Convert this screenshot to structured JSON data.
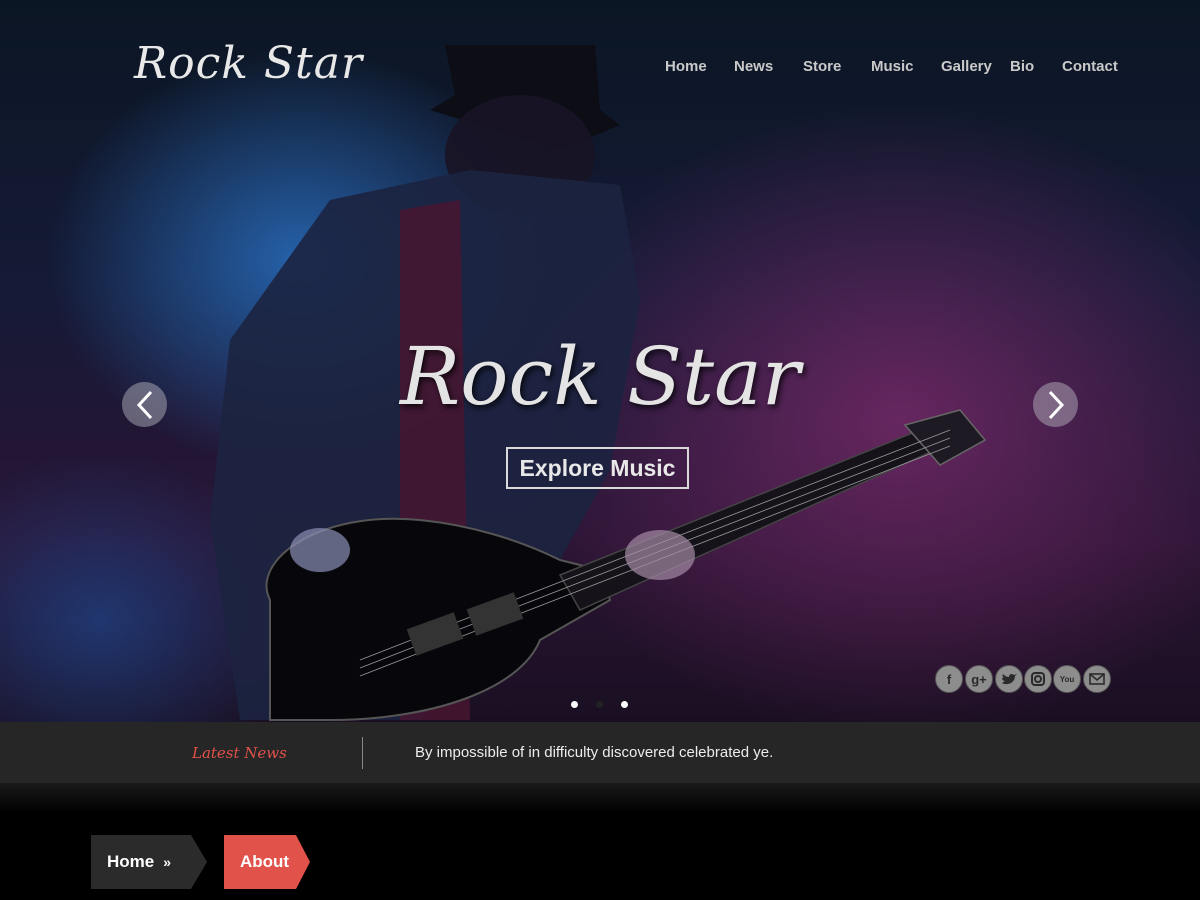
{
  "header": {
    "logo": "Rock Star",
    "nav": [
      "Home",
      "News",
      "Store",
      "Music",
      "Gallery",
      "Bio",
      "Contact"
    ]
  },
  "hero": {
    "title": "Rock Star",
    "button": "Explore Music",
    "prev_icon": "chevron-left-icon",
    "next_icon": "chevron-right-icon",
    "slides": 3,
    "active_slide": 1
  },
  "social": [
    "facebook-icon",
    "google-plus-icon",
    "twitter-icon",
    "instagram-icon",
    "youtube-icon",
    "email-icon"
  ],
  "news_ticker": {
    "label": "Latest News",
    "text": "By impossible of in difficulty discovered celebrated ye."
  },
  "breadcrumb": {
    "home": "Home",
    "separator": "»",
    "current": "About"
  },
  "colors": {
    "accent": "#e0524a",
    "newsbar": "#262626",
    "crumb_dark": "#2b2b2b"
  }
}
